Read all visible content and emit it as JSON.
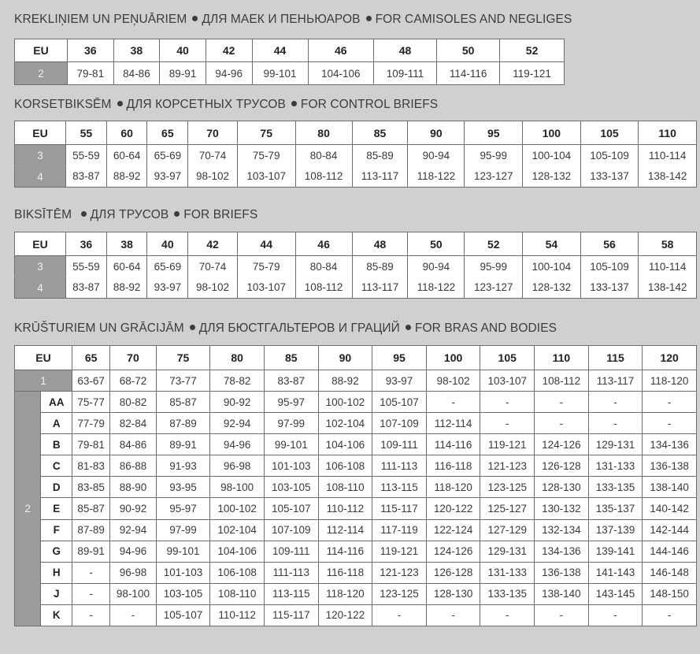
{
  "camisoles": {
    "title_parts": [
      "KREKLIŅIEM UN PEŅUĀRIEM",
      "ДЛЯ МАЕК И ПЕНЬЮАРОВ",
      "FOR CAMISOLES AND NEGLIGES"
    ],
    "header": [
      "EU",
      "36",
      "38",
      "40",
      "42",
      "44",
      "46",
      "48",
      "50",
      "52"
    ],
    "rows": [
      {
        "label": "2",
        "values": [
          "79-81",
          "84-86",
          "89-91",
          "94-96",
          "99-101",
          "104-106",
          "109-111",
          "114-116",
          "119-121"
        ]
      }
    ]
  },
  "control_briefs": {
    "title_parts": [
      "KORSETBIKSĒM",
      "ДЛЯ КОРСЕТНЫХ ТРУСОВ",
      "FOR CONTROL BRIEFS"
    ],
    "header": [
      "EU",
      "55",
      "60",
      "65",
      "70",
      "75",
      "80",
      "85",
      "90",
      "95",
      "100",
      "105",
      "110"
    ],
    "rows": [
      {
        "label": "3",
        "values": [
          "55-59",
          "60-64",
          "65-69",
          "70-74",
          "75-79",
          "80-84",
          "85-89",
          "90-94",
          "95-99",
          "100-104",
          "105-109",
          "110-114"
        ]
      },
      {
        "label": "4",
        "values": [
          "83-87",
          "88-92",
          "93-97",
          "98-102",
          "103-107",
          "108-112",
          "113-117",
          "118-122",
          "123-127",
          "128-132",
          "133-137",
          "138-142"
        ]
      }
    ]
  },
  "briefs": {
    "title_parts": [
      "BIKSĪTĒM ",
      "ДЛЯ ТРУСОВ",
      "FOR BRIEFS"
    ],
    "header": [
      "EU",
      "36",
      "38",
      "40",
      "42",
      "44",
      "46",
      "48",
      "50",
      "52",
      "54",
      "56",
      "58"
    ],
    "rows": [
      {
        "label": "3",
        "values": [
          "55-59",
          "60-64",
          "65-69",
          "70-74",
          "75-79",
          "80-84",
          "85-89",
          "90-94",
          "95-99",
          "100-104",
          "105-109",
          "110-114"
        ]
      },
      {
        "label": "4",
        "values": [
          "83-87",
          "88-92",
          "93-97",
          "98-102",
          "103-107",
          "108-112",
          "113-117",
          "118-122",
          "123-127",
          "128-132",
          "133-137",
          "138-142"
        ]
      }
    ]
  },
  "bras": {
    "title_parts": [
      "KRŪŠTURIEM UN GRĀCIJĀM",
      "ДЛЯ БЮСТГАЛЬТЕРОВ И ГРАЦИЙ",
      "FOR BRAS AND BODIES"
    ],
    "header": [
      "EU",
      "65",
      "70",
      "75",
      "80",
      "85",
      "90",
      "95",
      "100",
      "105",
      "110",
      "115",
      "120"
    ],
    "row1": {
      "label": "1",
      "values": [
        "63-67",
        "68-72",
        "73-77",
        "78-82",
        "83-87",
        "88-92",
        "93-97",
        "98-102",
        "103-107",
        "108-112",
        "113-117",
        "118-120"
      ]
    },
    "group_label": "2",
    "cups": [
      {
        "cup": "AA",
        "values": [
          "75-77",
          "80-82",
          "85-87",
          "90-92",
          "95-97",
          "100-102",
          "105-107",
          "-",
          "-",
          "-",
          "-",
          "-"
        ]
      },
      {
        "cup": "A",
        "values": [
          "77-79",
          "82-84",
          "87-89",
          "92-94",
          "97-99",
          "102-104",
          "107-109",
          "112-114",
          "-",
          "-",
          "-",
          "-"
        ]
      },
      {
        "cup": "B",
        "values": [
          "79-81",
          "84-86",
          "89-91",
          "94-96",
          "99-101",
          "104-106",
          "109-111",
          "114-116",
          "119-121",
          "124-126",
          "129-131",
          "134-136"
        ]
      },
      {
        "cup": "C",
        "values": [
          "81-83",
          "86-88",
          "91-93",
          "96-98",
          "101-103",
          "106-108",
          "111-113",
          "116-118",
          "121-123",
          "126-128",
          "131-133",
          "136-138"
        ]
      },
      {
        "cup": "D",
        "values": [
          "83-85",
          "88-90",
          "93-95",
          "98-100",
          "103-105",
          "108-110",
          "113-115",
          "118-120",
          "123-125",
          "128-130",
          "133-135",
          "138-140"
        ]
      },
      {
        "cup": "E",
        "values": [
          "85-87",
          "90-92",
          "95-97",
          "100-102",
          "105-107",
          "110-112",
          "115-117",
          "120-122",
          "125-127",
          "130-132",
          "135-137",
          "140-142"
        ]
      },
      {
        "cup": "F",
        "values": [
          "87-89",
          "92-94",
          "97-99",
          "102-104",
          "107-109",
          "112-114",
          "117-119",
          "122-124",
          "127-129",
          "132-134",
          "137-139",
          "142-144"
        ]
      },
      {
        "cup": "G",
        "values": [
          "89-91",
          "94-96",
          "99-101",
          "104-106",
          "109-111",
          "114-116",
          "119-121",
          "124-126",
          "129-131",
          "134-136",
          "139-141",
          "144-146"
        ]
      },
      {
        "cup": "H",
        "values": [
          "-",
          "96-98",
          "101-103",
          "106-108",
          "111-113",
          "116-118",
          "121-123",
          "126-128",
          "131-133",
          "136-138",
          "141-143",
          "146-148"
        ]
      },
      {
        "cup": "J",
        "values": [
          "-",
          "98-100",
          "103-105",
          "108-110",
          "113-115",
          "118-120",
          "123-125",
          "128-130",
          "133-135",
          "138-140",
          "143-145",
          "148-150"
        ]
      },
      {
        "cup": "K",
        "values": [
          "-",
          "-",
          "105-107",
          "110-112",
          "115-117",
          "120-122",
          "-",
          "-",
          "-",
          "-",
          "-",
          "-"
        ]
      }
    ]
  }
}
